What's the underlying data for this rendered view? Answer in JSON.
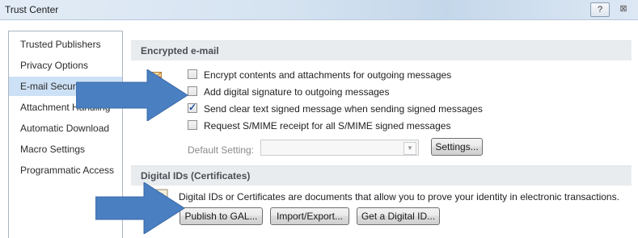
{
  "window": {
    "title": "Trust Center",
    "help_icon": "?",
    "close_icon": "⊠"
  },
  "nav": {
    "items": [
      {
        "label": "Trusted Publishers"
      },
      {
        "label": "Privacy Options"
      },
      {
        "label": "E-mail Security",
        "selected": true
      },
      {
        "label": "Attachment Handling"
      },
      {
        "label": "Automatic Download"
      },
      {
        "label": "Macro Settings"
      },
      {
        "label": "Programmatic Access"
      }
    ]
  },
  "encrypted": {
    "header": "Encrypted e-mail",
    "options": [
      {
        "label": "Encrypt contents and attachments for outgoing messages",
        "checked": false
      },
      {
        "label": "Add digital signature to outgoing messages",
        "checked": false
      },
      {
        "label": "Send clear text signed message when sending signed messages",
        "checked": true
      },
      {
        "label": "Request S/MIME receipt for all S/MIME signed messages",
        "checked": false
      }
    ],
    "default_setting_label": "Default Setting:",
    "default_setting_value": "",
    "settings_button": "Settings..."
  },
  "digital_ids": {
    "header": "Digital IDs (Certificates)",
    "description": "Digital IDs or Certificates are documents that allow you to prove your identity in electronic transactions.",
    "publish_button": "Publish to GAL...",
    "import_export_button": "Import/Export...",
    "get_id_button": "Get a Digital ID..."
  },
  "colors": {
    "arrow": "#4a7fc1",
    "selected_nav": "#cde1f6",
    "section_header": "#e9ecef"
  }
}
